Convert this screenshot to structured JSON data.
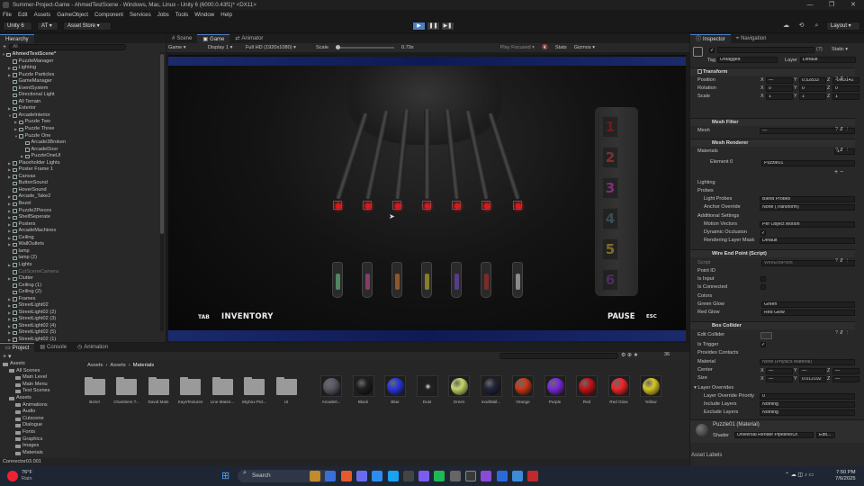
{
  "window": {
    "title": "Summer-Project-Game - AhmedTestScene - Windows, Mac, Linux - Unity 6 (6000.0.43f1)* <DX11>",
    "controls": [
      "—",
      "❐",
      "✕"
    ]
  },
  "menu": [
    "File",
    "Edit",
    "Assets",
    "GameObject",
    "Component",
    "Services",
    "Jobs",
    "Tools",
    "Window",
    "Help"
  ],
  "toolbar": {
    "unity_label": "Unity 6",
    "account_label": "AT",
    "asset_store_label": "Asset Store",
    "layout_label": "Layout",
    "play_icons": [
      "▶",
      "❚❚",
      "▶❚"
    ]
  },
  "hierarchy": {
    "tab": "Hierarchy",
    "search_placeholder": "All",
    "scene": "AhmedTestScene*",
    "items": [
      {
        "label": "PuzzleManager",
        "indent": 1,
        "expand": ""
      },
      {
        "label": "Lighting",
        "indent": 1,
        "expand": "▶"
      },
      {
        "label": "Puzzle Particles",
        "indent": 1,
        "expand": "▶"
      },
      {
        "label": "GameManager",
        "indent": 1,
        "expand": ""
      },
      {
        "label": "EventSystem",
        "indent": 1,
        "expand": ""
      },
      {
        "label": "Directional Light",
        "indent": 1,
        "expand": ""
      },
      {
        "label": "All Terrain",
        "indent": 1,
        "expand": ""
      },
      {
        "label": "Exterior",
        "indent": 1,
        "expand": "▶"
      },
      {
        "label": "ArcadeInterior",
        "indent": 1,
        "expand": "▼"
      },
      {
        "label": "Puzzle Two",
        "indent": 2,
        "expand": "▶"
      },
      {
        "label": "Puzzle Three",
        "indent": 2,
        "expand": "▶"
      },
      {
        "label": "Puzzle One",
        "indent": 2,
        "expand": "▼"
      },
      {
        "label": "Arcade3Broken",
        "indent": 3,
        "expand": ""
      },
      {
        "label": "ArcadeDoor",
        "indent": 3,
        "expand": ""
      },
      {
        "label": "PuzzleOneUI",
        "indent": 3,
        "expand": "▶"
      },
      {
        "label": "Placeholder Lights",
        "indent": 1,
        "expand": "▶"
      },
      {
        "label": "Poster Frame 1",
        "indent": 1,
        "expand": "▶"
      },
      {
        "label": "Canvas",
        "indent": 1,
        "expand": "▶"
      },
      {
        "label": "ButtonSound",
        "indent": 1,
        "expand": ""
      },
      {
        "label": "HoverSound",
        "indent": 1,
        "expand": ""
      },
      {
        "label": "Arcade_Take2",
        "indent": 1,
        "expand": "▶"
      },
      {
        "label": "Bezel",
        "indent": 1,
        "expand": "▶"
      },
      {
        "label": "Puzzle2Pieces",
        "indent": 1,
        "expand": "▶"
      },
      {
        "label": "ShelfSeperate",
        "indent": 1,
        "expand": "▶"
      },
      {
        "label": "Posters",
        "indent": 1,
        "expand": "▶"
      },
      {
        "label": "ArcadeMachines",
        "indent": 1,
        "expand": "▶"
      },
      {
        "label": "Ceiling",
        "indent": 1,
        "expand": "▶"
      },
      {
        "label": "WallOutlets",
        "indent": 1,
        "expand": "▶"
      },
      {
        "label": "lamp",
        "indent": 1,
        "expand": ""
      },
      {
        "label": "lamp (2)",
        "indent": 1,
        "expand": ""
      },
      {
        "label": "Lights",
        "indent": 1,
        "expand": "▶"
      },
      {
        "label": "CutSceneCamera",
        "indent": 1,
        "expand": "",
        "dim": true
      },
      {
        "label": "Clutter",
        "indent": 1,
        "expand": "▶"
      },
      {
        "label": "Ceiling (1)",
        "indent": 1,
        "expand": ""
      },
      {
        "label": "Ceiling (2)",
        "indent": 1,
        "expand": ""
      },
      {
        "label": "Frames",
        "indent": 1,
        "expand": "▶"
      },
      {
        "label": "StreetLight02",
        "indent": 1,
        "expand": "▶"
      },
      {
        "label": "StreetLight02 (2)",
        "indent": 1,
        "expand": "▶"
      },
      {
        "label": "StreetLight02 (3)",
        "indent": 1,
        "expand": "▶"
      },
      {
        "label": "StreetLight02 (4)",
        "indent": 1,
        "expand": "▶"
      },
      {
        "label": "StreetLight02 (5)",
        "indent": 1,
        "expand": "▶"
      },
      {
        "label": "StreetLight02 (1)",
        "indent": 1,
        "expand": "▶"
      }
    ]
  },
  "view_tabs": [
    "Scene",
    "Game",
    "Animator"
  ],
  "game_toolbar": {
    "mode": "Game",
    "display": "Display 1",
    "resolution": "Full HD (1920x1080)",
    "scale_label": "Scale",
    "scale_value": "0.79x",
    "play_focused": "Play Focused",
    "stats": "Stats",
    "gizmos": "Gizmos"
  },
  "game": {
    "tab_key": "TAB",
    "inventory": "INVENTORY",
    "pause": "PAUSE",
    "esc": "ESC",
    "numbers": [
      "1",
      "2",
      "3",
      "4",
      "5",
      "6"
    ],
    "number_colors": [
      "#a11",
      "#b33",
      "#b3a",
      "#467",
      "#b93",
      "#638"
    ],
    "led_count": 7,
    "plug_colors": [
      "#6ecf8a",
      "#d04aa0",
      "#e07a2a",
      "#d4c028",
      "#7a4ad8",
      "#c02a2a",
      "#d8d8d8"
    ]
  },
  "inspector": {
    "tabs": [
      "Inspector",
      "Navigation"
    ],
    "object_name": "",
    "static_label": "Static",
    "tag_label": "Tag",
    "tag_value": "Untagged",
    "layer_label": "Layer",
    "layer_value": "Default",
    "count_badge": "(7)",
    "transform": {
      "title": "Transform",
      "position_label": "Position",
      "rotation_label": "Rotation",
      "scale_label": "Scale",
      "pos": [
        "—",
        "0.52833",
        "-0.03142"
      ],
      "rot": [
        "0",
        "0",
        "0"
      ],
      "scl": [
        "1",
        "1",
        "1"
      ]
    },
    "mesh_filter": {
      "title": "Mesh Filter",
      "mesh_label": "Mesh",
      "mesh_value": "—"
    },
    "mesh_renderer": {
      "title": "Mesh Renderer",
      "materials_label": "Materials",
      "materials_count": "1",
      "element_label": "Element 0",
      "element_value": "Puzzle01",
      "lighting": "Lighting",
      "probes": "Probes",
      "light_probes_label": "Light Probes",
      "light_probes_value": "Blend Probes",
      "anchor_label": "Anchor Override",
      "anchor_value": "None (Transform)",
      "additional": "Additional Settings",
      "motion_label": "Motion Vectors",
      "motion_value": "Per Object Motion",
      "occlusion_label": "Dynamic Occlusion",
      "rlm_label": "Rendering Layer Mask",
      "rlm_value": "Default"
    },
    "wire_script": {
      "title": "Wire End Point (Script)",
      "script_label": "Script",
      "script_value": "WireEndPoint",
      "point_id": "Point ID",
      "is_input": "Is Input",
      "is_connected": "Is Connected",
      "colors": "Colors",
      "green_glow_label": "Green Glow",
      "green_glow_value": "Green",
      "red_glow_label": "Red Glow",
      "red_glow_value": "Red Glow"
    },
    "box_collider": {
      "title": "Box Collider",
      "edit_collider": "Edit Collider",
      "is_trigger": "Is Trigger",
      "provides_contacts": "Provides Contacts",
      "material_label": "Material",
      "material_value": "None (Physics Material)",
      "center_label": "Center",
      "size_label": "Size",
      "center": [
        "—",
        "—",
        "—"
      ],
      "size": [
        "—",
        "0.012192",
        "—"
      ]
    },
    "layer_overrides": {
      "title": "Layer Overrides",
      "priority_label": "Layer Override Priority",
      "priority_value": "0",
      "include_label": "Include Layers",
      "include_value": "Nothing",
      "exclude_label": "Exclude Layers",
      "exclude_value": "Nothing"
    },
    "material_section": {
      "name": "Puzzle01 (Material)",
      "shader_label": "Shader",
      "shader_value": "Universal Render Pipeline/Lit",
      "edit": "Edit..."
    },
    "asset_labels": "Asset Labels"
  },
  "project": {
    "tabs": [
      "Project",
      "Console",
      "Animation"
    ],
    "tree": [
      {
        "label": "Assets",
        "indent": 0
      },
      {
        "label": "All Scenes",
        "indent": 1
      },
      {
        "label": "Main Level",
        "indent": 2
      },
      {
        "label": "Main Menu",
        "indent": 2
      },
      {
        "label": "Test Scenes",
        "indent": 2
      },
      {
        "label": "Assets",
        "indent": 1
      },
      {
        "label": "Animations",
        "indent": 2
      },
      {
        "label": "Audio",
        "indent": 2
      },
      {
        "label": "Cutscene",
        "indent": 2
      },
      {
        "label": "Dialogue",
        "indent": 2
      },
      {
        "label": "Fonts",
        "indent": 2
      },
      {
        "label": "Graphics",
        "indent": 2
      },
      {
        "label": "Images",
        "indent": 2
      },
      {
        "label": "Materials",
        "indent": 2
      }
    ],
    "breadcrumb": [
      "Assets",
      "Assets",
      "Materials"
    ],
    "folders": [
      "Bezel",
      "Chambers T...",
      "David Mats",
      "KaysTextures",
      "Line Materi...",
      "Skybox Pict...",
      "UI"
    ],
    "materials": [
      {
        "name": "Arcade0...",
        "color": "#5a5a66"
      },
      {
        "name": "Black",
        "color": "#202020"
      },
      {
        "name": "Blue",
        "color": "#2a38d8"
      },
      {
        "name": "Dust",
        "color": "#2a2a2a"
      },
      {
        "name": "Green",
        "color": "#c7d96a"
      },
      {
        "name": "modWall...",
        "color": "#23263a"
      },
      {
        "name": "Orange",
        "color": "#c73a1a"
      },
      {
        "name": "Purple",
        "color": "#7a2ad8"
      },
      {
        "name": "Red",
        "color": "#c0161b"
      },
      {
        "name": "Red Glow",
        "color": "#f0282b"
      },
      {
        "name": "Yellow",
        "color": "#d8c828"
      }
    ],
    "footer": "Connector03.001",
    "count": "36"
  },
  "taskbar": {
    "temp": "76°F",
    "weather": "Rain",
    "search": "Search",
    "time": "7:50 PM",
    "date": "7/6/2025"
  },
  "colors": {
    "accent": "#4c7ec6",
    "bg": "#191919",
    "panel": "#282828"
  }
}
